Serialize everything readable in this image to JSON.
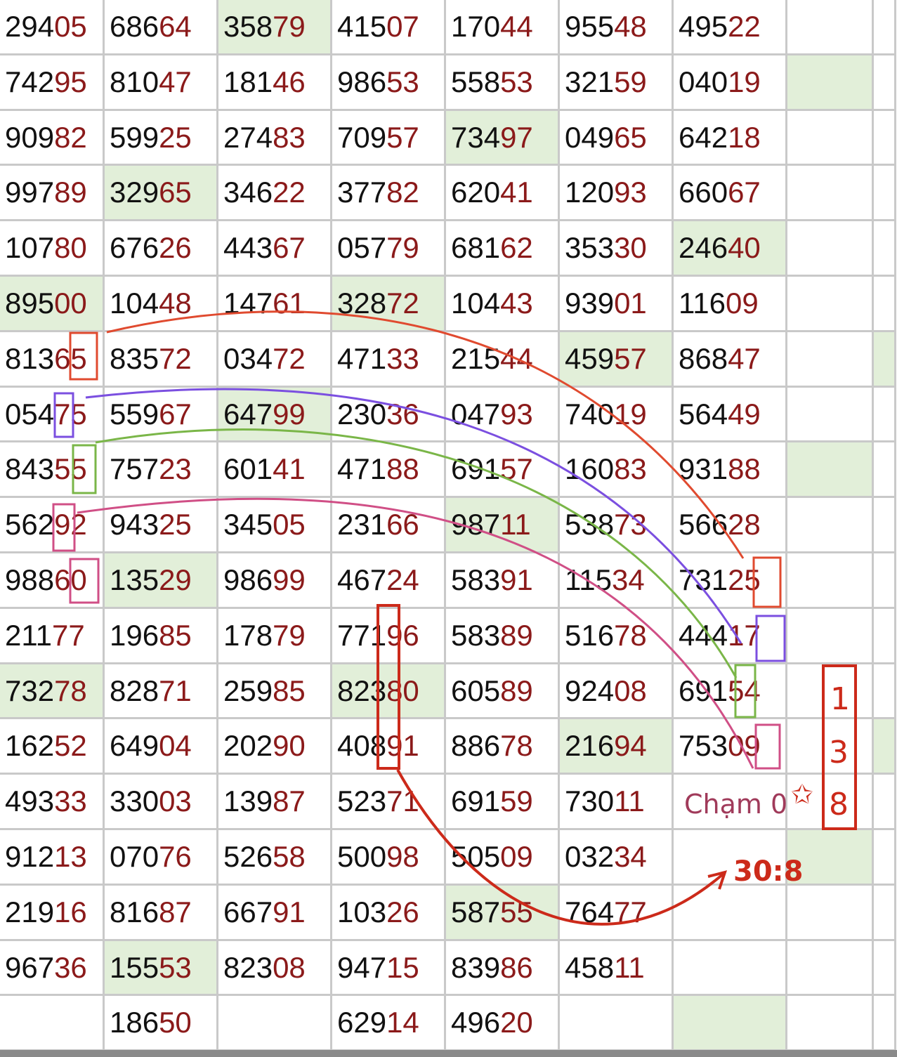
{
  "rows": [
    [
      "29405",
      "68664",
      "35879",
      "41507",
      "17044",
      "95548",
      "49522"
    ],
    [
      "74295",
      "81047",
      "18146",
      "98653",
      "55853",
      "32159",
      "04019"
    ],
    [
      "90982",
      "59925",
      "27483",
      "70957",
      "73497",
      "04965",
      "64218"
    ],
    [
      "99789",
      "32965",
      "34622",
      "37782",
      "62041",
      "12093",
      "66067"
    ],
    [
      "10780",
      "67626",
      "44367",
      "05779",
      "68162",
      "35330",
      "24640"
    ],
    [
      "89500",
      "10448",
      "14761",
      "32872",
      "10443",
      "93901",
      "11609"
    ],
    [
      "81365",
      "83572",
      "03472",
      "47133",
      "21544",
      "45957",
      "86847"
    ],
    [
      "05475",
      "55967",
      "64799",
      "23036",
      "04793",
      "74019",
      "56449"
    ],
    [
      "84355",
      "75723",
      "60141",
      "47188",
      "69157",
      "16083",
      "93188"
    ],
    [
      "56292",
      "94325",
      "34505",
      "23166",
      "98711",
      "53873",
      "56628"
    ],
    [
      "98860",
      "13529",
      "98699",
      "46724",
      "58391",
      "11534",
      "73125"
    ],
    [
      "21177",
      "19685",
      "17879",
      "77196",
      "58389",
      "51678",
      "44417"
    ],
    [
      "73278",
      "82871",
      "25985",
      "82380",
      "60589",
      "92408",
      "69154"
    ],
    [
      "16252",
      "64904",
      "20290",
      "40891",
      "88678",
      "21694",
      "75309"
    ],
    [
      "49333",
      "33003",
      "13987",
      "52371",
      "69159",
      "73011",
      ""
    ],
    [
      "91213",
      "07076",
      "52658",
      "50098",
      "50509",
      "03234",
      ""
    ],
    [
      "21916",
      "81687",
      "66791",
      "10326",
      "58755",
      "76477",
      ""
    ],
    [
      "96736",
      "15553",
      "82308",
      "94715",
      "83986",
      "45811",
      ""
    ],
    [
      "",
      "18650",
      "",
      "62914",
      "49620",
      "",
      ""
    ]
  ],
  "highlighted_cells": [
    [
      0,
      2
    ],
    [
      1,
      7
    ],
    [
      2,
      4
    ],
    [
      3,
      1
    ],
    [
      4,
      6
    ],
    [
      5,
      0
    ],
    [
      5,
      3
    ],
    [
      6,
      5
    ],
    [
      6,
      8
    ],
    [
      7,
      2
    ],
    [
      8,
      7
    ],
    [
      9,
      4
    ],
    [
      10,
      1
    ],
    [
      12,
      0
    ],
    [
      12,
      3
    ],
    [
      13,
      5
    ],
    [
      13,
      8
    ],
    [
      15,
      7
    ],
    [
      16,
      4
    ],
    [
      17,
      1
    ],
    [
      18,
      6
    ]
  ],
  "annotations": {
    "cham_label": "Chạm 0",
    "star": "✩",
    "boxed_digits": [
      "1",
      "3",
      "8"
    ],
    "ratio_label": "30:8"
  },
  "colors": {
    "head_digit": "#111111",
    "tail_digit": "#8b1a1a",
    "highlight": "#e2efd9",
    "grid_line": "#c9c9c9",
    "red": "#e04a2f",
    "purple": "#7b4fe0",
    "green": "#7ab648",
    "pink": "#d04f86",
    "dark_red": "#cc2a1a"
  }
}
